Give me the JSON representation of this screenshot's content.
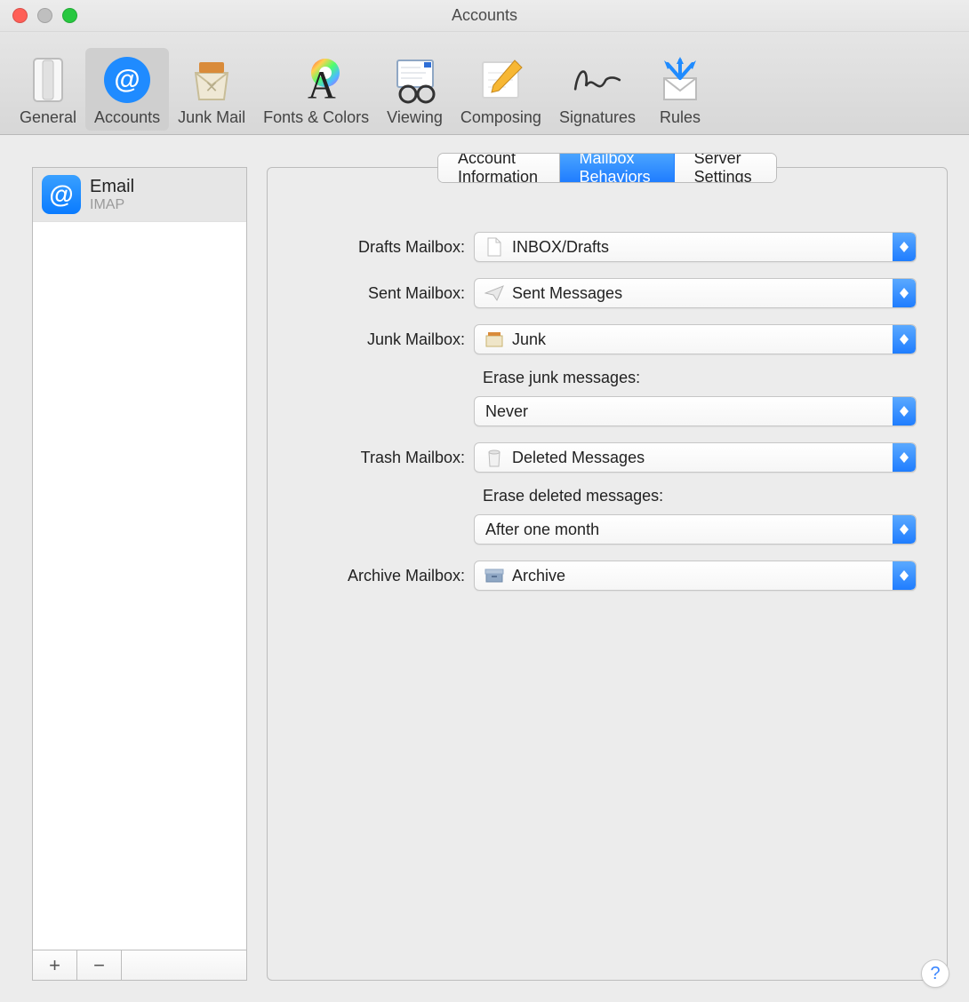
{
  "window": {
    "title": "Accounts"
  },
  "toolbar": {
    "items": [
      {
        "label": "General"
      },
      {
        "label": "Accounts"
      },
      {
        "label": "Junk Mail"
      },
      {
        "label": "Fonts & Colors"
      },
      {
        "label": "Viewing"
      },
      {
        "label": "Composing"
      },
      {
        "label": "Signatures"
      },
      {
        "label": "Rules"
      }
    ],
    "active_index": 1
  },
  "sidebar": {
    "accounts": [
      {
        "name": "Email",
        "type": "IMAP"
      }
    ],
    "selected_index": 0,
    "add_glyph": "+",
    "remove_glyph": "−"
  },
  "tabs": {
    "items": [
      {
        "label": "Account Information"
      },
      {
        "label": "Mailbox Behaviors"
      },
      {
        "label": "Server Settings"
      }
    ],
    "active_index": 1
  },
  "form": {
    "drafts": {
      "label": "Drafts Mailbox:",
      "value": "INBOX/Drafts"
    },
    "sent": {
      "label": "Sent Mailbox:",
      "value": "Sent Messages"
    },
    "junk": {
      "label": "Junk Mailbox:",
      "value": "Junk"
    },
    "erase_junk_label": "Erase junk messages:",
    "erase_junk_value": "Never",
    "trash": {
      "label": "Trash Mailbox:",
      "value": "Deleted Messages"
    },
    "erase_deleted_label": "Erase deleted messages:",
    "erase_deleted_value": "After one month",
    "archive": {
      "label": "Archive Mailbox:",
      "value": "Archive"
    }
  },
  "help_glyph": "?"
}
